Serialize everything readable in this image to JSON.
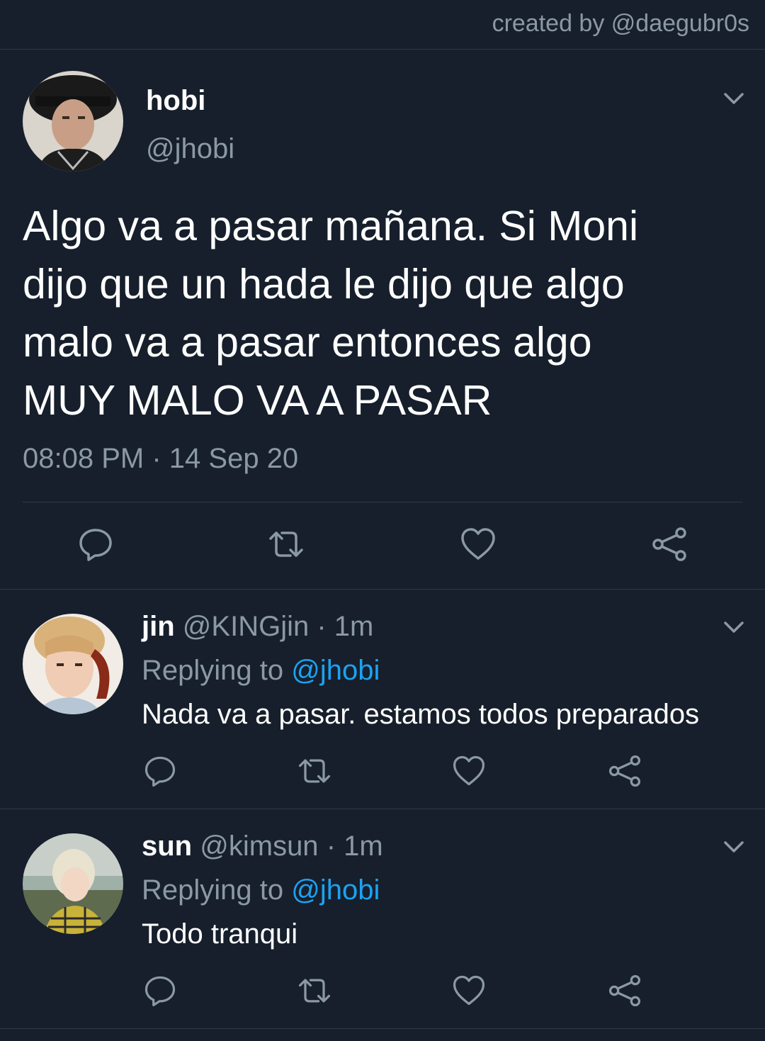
{
  "credit": "created by @daegubr0s",
  "main_tweet": {
    "name": "hobi",
    "handle": "@jhobi",
    "text_lines": [
      "Algo va a pasar mañana. Si Moni",
      "dijo que un hada le dijo que algo",
      "malo va a pasar entonces algo",
      "MUY MALO VA A PASAR"
    ],
    "time": "08:08 PM",
    "separator": "·",
    "date": "14 Sep 20"
  },
  "replies": [
    {
      "name": "jin",
      "handle": "@KINGjin",
      "separator": "·",
      "age": "1m",
      "replying_label": "Replying to",
      "replying_handle": "@jhobi",
      "text": "Nada va a pasar. estamos todos preparados"
    },
    {
      "name": "sun",
      "handle": "@kimsun",
      "separator": "·",
      "age": "1m",
      "replying_label": "Replying to",
      "replying_handle": "@jhobi",
      "text": "Todo tranqui"
    }
  ],
  "icons": {
    "reply": "reply-icon",
    "retweet": "retweet-icon",
    "like": "heart-icon",
    "share": "share-icon",
    "more": "chevron-down-icon"
  },
  "colors": {
    "background": "#161f2b",
    "muted": "#8b98a5",
    "link": "#1da1f2",
    "divider": "#2f3b4a"
  }
}
